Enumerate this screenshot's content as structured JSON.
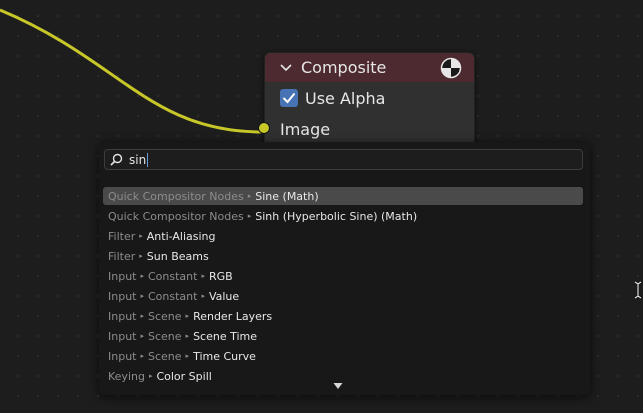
{
  "node": {
    "title": "Composite",
    "use_alpha_label": "Use Alpha",
    "use_alpha_checked": true,
    "socket_label": "Image",
    "header_color": "#4d2a2f",
    "socket_color": "#c7c729"
  },
  "wire_color": "#c7c729",
  "search": {
    "query": "sin"
  },
  "results": [
    {
      "path": [
        "Quick Compositor Nodes"
      ],
      "name": "Sine (Math)",
      "selected": true
    },
    {
      "path": [
        "Quick Compositor Nodes"
      ],
      "name": "Sinh (Hyperbolic Sine) (Math)",
      "selected": false
    },
    {
      "path": [
        "Filter"
      ],
      "name": "Anti-Aliasing",
      "selected": false
    },
    {
      "path": [
        "Filter"
      ],
      "name": "Sun Beams",
      "selected": false
    },
    {
      "path": [
        "Input",
        "Constant"
      ],
      "name": "RGB",
      "selected": false
    },
    {
      "path": [
        "Input",
        "Constant"
      ],
      "name": "Value",
      "selected": false
    },
    {
      "path": [
        "Input",
        "Scene"
      ],
      "name": "Render Layers",
      "selected": false
    },
    {
      "path": [
        "Input",
        "Scene"
      ],
      "name": "Scene Time",
      "selected": false
    },
    {
      "path": [
        "Input",
        "Scene"
      ],
      "name": "Time Curve",
      "selected": false
    },
    {
      "path": [
        "Keying"
      ],
      "name": "Color Spill",
      "selected": false
    }
  ],
  "icons": {
    "collapse": "chevron-down-icon",
    "node_type": "composite-output-icon",
    "search": "magnifier-icon",
    "more": "triangle-down-icon",
    "cursor": "text-cursor-icon"
  }
}
